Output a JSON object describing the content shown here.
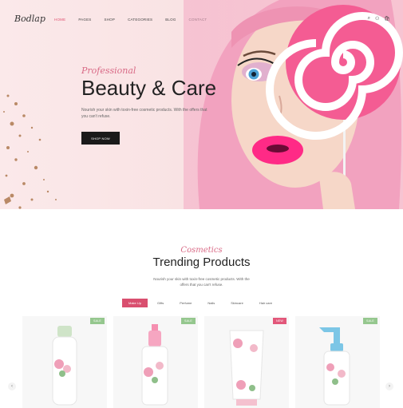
{
  "header": {
    "logo": "Bodlap",
    "nav": [
      {
        "label": "Home",
        "active": true
      },
      {
        "label": "Pages"
      },
      {
        "label": "Shop"
      },
      {
        "label": "Categories"
      },
      {
        "label": "Blog"
      },
      {
        "label": "Contact"
      }
    ],
    "icons": [
      "search-icon",
      "user-icon",
      "cart-icon"
    ],
    "cart_count": "0"
  },
  "hero": {
    "script_text": "Professional",
    "title": "Beauty & Care",
    "description": "Nourish your skin with toxin-free cosmetic products. With the offers that you can't refuse.",
    "button": "SHOP NOW"
  },
  "trending": {
    "script_text": "Cosmetics",
    "title": "Trending Products",
    "description": "Nourish your skin with toxin-free cosmetic products. With the offers that you can't refuse.",
    "tabs": [
      {
        "label": "Make Up",
        "active": true
      },
      {
        "label": "Gifts"
      },
      {
        "label": "Perfume"
      },
      {
        "label": "Nails"
      },
      {
        "label": "Skincare"
      },
      {
        "label": "Hair care"
      }
    ],
    "products": [
      {
        "badge": "SALE",
        "badge_color": "#95c78e",
        "type": "bottle"
      },
      {
        "badge": "SALE",
        "badge_color": "#95c78e",
        "type": "spray"
      },
      {
        "badge": "NEW",
        "badge_color": "#e2577a",
        "type": "tube"
      },
      {
        "badge": "SALE",
        "badge_color": "#95c78e",
        "type": "pump"
      }
    ]
  },
  "colors": {
    "accent": "#e0506f",
    "dark": "#1a1a1a",
    "hero_bg": "#f9e3e4"
  }
}
